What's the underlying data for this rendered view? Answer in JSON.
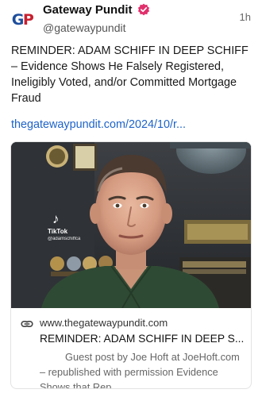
{
  "account": {
    "avatar_initials": "GP",
    "display_name": "Gateway Pundit",
    "handle": "@gatewaypundit",
    "verified": true,
    "timestamp": "1h"
  },
  "post": {
    "text": "REMINDER: ADAM SCHIFF IN DEEP SCHIFF – Evidence Shows He Falsely Registered, Ineligibly Voted, and/or Committed Mortgage Fraud",
    "link_text": "thegatewaypundit.com/2024/10/r..."
  },
  "link_card": {
    "thumbnail_overlay": {
      "brand": "TikTok",
      "handle": "@adamschiffca"
    },
    "domain": "www.thegatewaypundit.com",
    "title": "REMINDER: ADAM SCHIFF IN DEEP S...",
    "description": "Guest post by Joe Hoft at JoeHoft.com – republished with permission Evidence Shows that Rep."
  },
  "icons": {
    "verified": "verified-badge-icon",
    "link": "link-icon",
    "tiktok": "tiktok-icon"
  },
  "colors": {
    "link": "#1d63c9",
    "verified": "#e1306c",
    "brand_blue": "#1e4e9c",
    "brand_red": "#c8202f"
  }
}
